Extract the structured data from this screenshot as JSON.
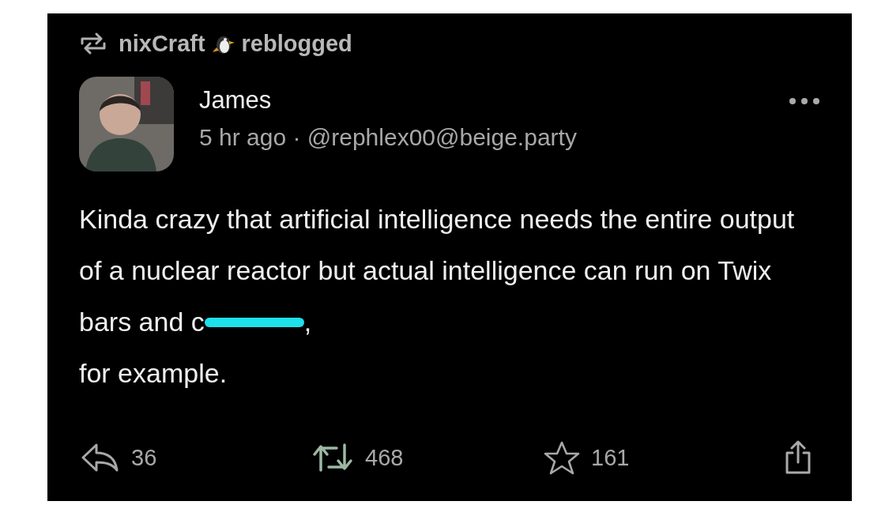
{
  "reblog": {
    "user": "nixCraft",
    "label": "reblogged"
  },
  "author": {
    "name": "James",
    "time": "5 hr ago",
    "separator": "·",
    "handle": "@rephlex00@beige.party"
  },
  "body": {
    "before": "Kinda crazy that artificial intelligence needs the entire output of a nuclear reactor but actual intelligence can run on Twix bars and c",
    "redacted": true,
    "after": ",",
    "last_line": "for example."
  },
  "actions": [
    {
      "kind": "reply",
      "count": "36"
    },
    {
      "kind": "boost",
      "count": "468"
    },
    {
      "kind": "favourite",
      "count": "161"
    },
    {
      "kind": "share"
    }
  ]
}
